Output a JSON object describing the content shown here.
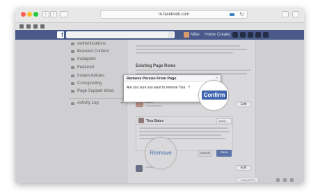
{
  "browser": {
    "url": "m.facebook.com"
  },
  "facebook_bar": {
    "logo": "f",
    "profile_name": "Mike",
    "home_label": "Home",
    "create_label": "Create"
  },
  "left_nav": {
    "items": [
      {
        "label": "Authentications"
      },
      {
        "label": "Branded Content"
      },
      {
        "label": "Instagram"
      },
      {
        "label": "Featured"
      },
      {
        "label": "Instant Articles"
      },
      {
        "label": "Crossposting"
      },
      {
        "label": "Page Support Inbox"
      }
    ],
    "activity_log": "Activity Log"
  },
  "main": {
    "section_title": "Existing Page Roles",
    "roles": [
      {
        "name": "Mike"
      },
      {
        "name": "Tina Bates"
      }
    ],
    "edit_label": "Edit",
    "role_select": "Admin",
    "save_label": "Save",
    "cancel_label": "Cancel"
  },
  "dialog": {
    "title": "Remove Person From Page",
    "message": "Are you sure you want to remove Tina",
    "cursor": "?",
    "cancel_label": "Can",
    "close": "×"
  },
  "callouts": {
    "confirm_label": "Confirm",
    "remove_label": "Remove"
  },
  "status": {
    "chat": "Chat (OFF)"
  },
  "colors": {
    "facebook_blue": "#48598a",
    "button_blue": "#4267b2",
    "remove_text": "#4b6fb0"
  }
}
